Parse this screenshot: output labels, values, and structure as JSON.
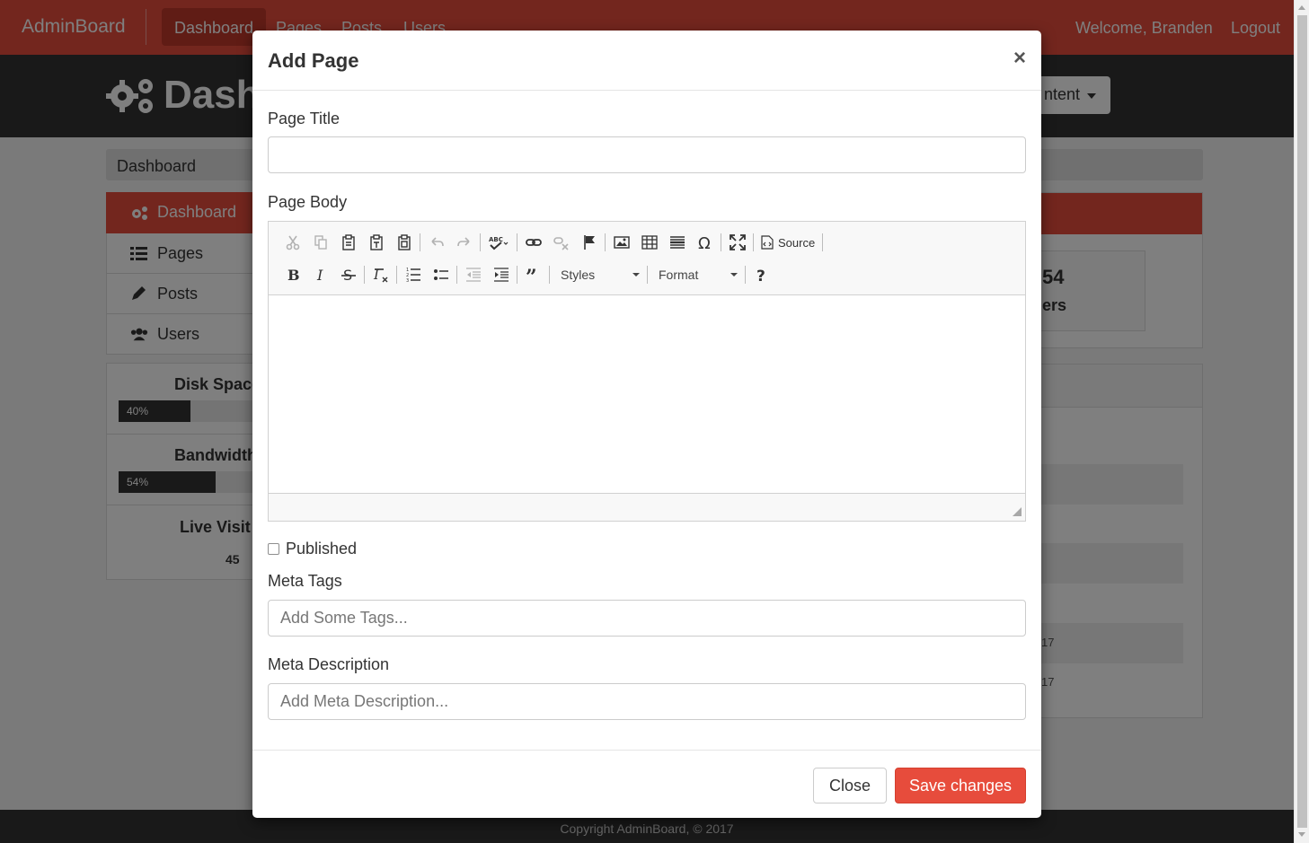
{
  "navbar": {
    "brand": "AdminBoard",
    "links": [
      "Dashboard",
      "Pages",
      "Posts",
      "Users"
    ],
    "welcome": "Welcome, Branden",
    "logout": "Logout"
  },
  "header": {
    "title": "Dash",
    "button_label": "ntent"
  },
  "breadcrumb": "Dashboard",
  "sidebar": {
    "items": [
      {
        "label": "Dashboard",
        "icon": "gears-icon"
      },
      {
        "label": "Pages",
        "icon": "list-icon"
      },
      {
        "label": "Posts",
        "icon": "pencil-icon"
      },
      {
        "label": "Users",
        "icon": "users-icon"
      }
    ]
  },
  "stats": {
    "disk_space": {
      "title": "Disk Space",
      "percent": 40,
      "label": "40%"
    },
    "bandwidth": {
      "title": "Bandwidth",
      "percent": 54,
      "label": "54%"
    },
    "live_visitors": {
      "title": "Live Visit",
      "value": "45"
    }
  },
  "main_panel": {
    "widget_number": "54",
    "widget_label": "ers"
  },
  "table_rows": [
    "17",
    "17"
  ],
  "footer": "Copyright AdminBoard, © 2017",
  "modal": {
    "title": "Add Page",
    "close_glyph": "×",
    "page_title_label": "Page Title",
    "page_title_value": "",
    "page_body_label": "Page Body",
    "published_label": "Published",
    "published_checked": false,
    "meta_tags_label": "Meta Tags",
    "meta_tags_placeholder": "Add Some Tags...",
    "meta_description_label": "Meta Description",
    "meta_description_placeholder": "Add Meta Description...",
    "close_button": "Close",
    "save_button": "Save changes"
  },
  "editor_toolbar": {
    "source_label": "Source",
    "styles_label": "Styles",
    "format_label": "Format",
    "row1_icons": [
      "cut-icon",
      "copy-icon",
      "paste-icon",
      "paste-text-icon",
      "paste-word-icon",
      "undo-icon",
      "redo-icon",
      "spellcheck-icon",
      "link-icon",
      "unlink-icon",
      "anchor-icon",
      "image-icon",
      "table-icon",
      "horizontal-rule-icon",
      "special-char-icon",
      "maximize-icon",
      "source-icon"
    ],
    "row2_icons": [
      "bold-icon",
      "italic-icon",
      "strike-icon",
      "remove-format-icon",
      "numbered-list-icon",
      "bulleted-list-icon",
      "outdent-icon",
      "indent-icon",
      "blockquote-icon",
      "help-icon"
    ]
  },
  "colors": {
    "accent": "#e74c3c",
    "accent_dark": "#c0392b",
    "dark": "#333333"
  }
}
